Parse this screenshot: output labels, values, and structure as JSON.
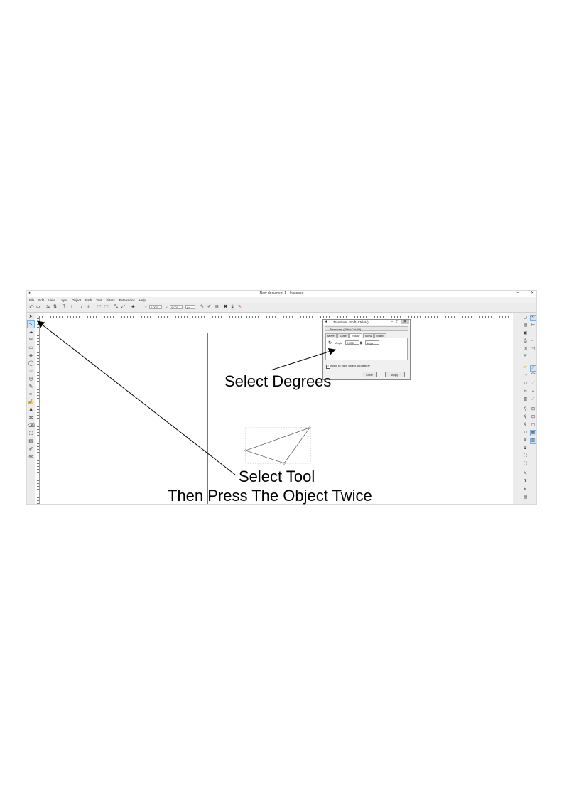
{
  "window": {
    "title": "New document 1 - Inkscape",
    "controls": [
      "–",
      "□",
      "✕"
    ]
  },
  "menu": [
    "File",
    "Edit",
    "View",
    "Layer",
    "Object",
    "Path",
    "Text",
    "Filters",
    "Extensions",
    "Help"
  ],
  "toolbar": {
    "x_label": "X",
    "x_value": "0.000",
    "y_label": "Y",
    "y_value": "0.000",
    "unit": "px"
  },
  "dialog": {
    "title": "Transform (Shift+Ctrl+M)",
    "panel_header": "Transform (Shift+Ctrl+M)",
    "tabs": [
      "Move",
      "Scale",
      "Rotate",
      "Skew",
      "Matrix"
    ],
    "active_tab": "Rotate",
    "angle_label": "Angle",
    "angle_value": "0.000",
    "unit": "deg",
    "apply_each_label": "Apply to each object separately",
    "apply_each_checked": true,
    "clear_label": "Clear",
    "apply_label": "Apply"
  },
  "annotations": {
    "select_degrees": "Select Degrees",
    "select_tool": "Select Tool",
    "press_twice": "Then Press The Object Twice"
  }
}
